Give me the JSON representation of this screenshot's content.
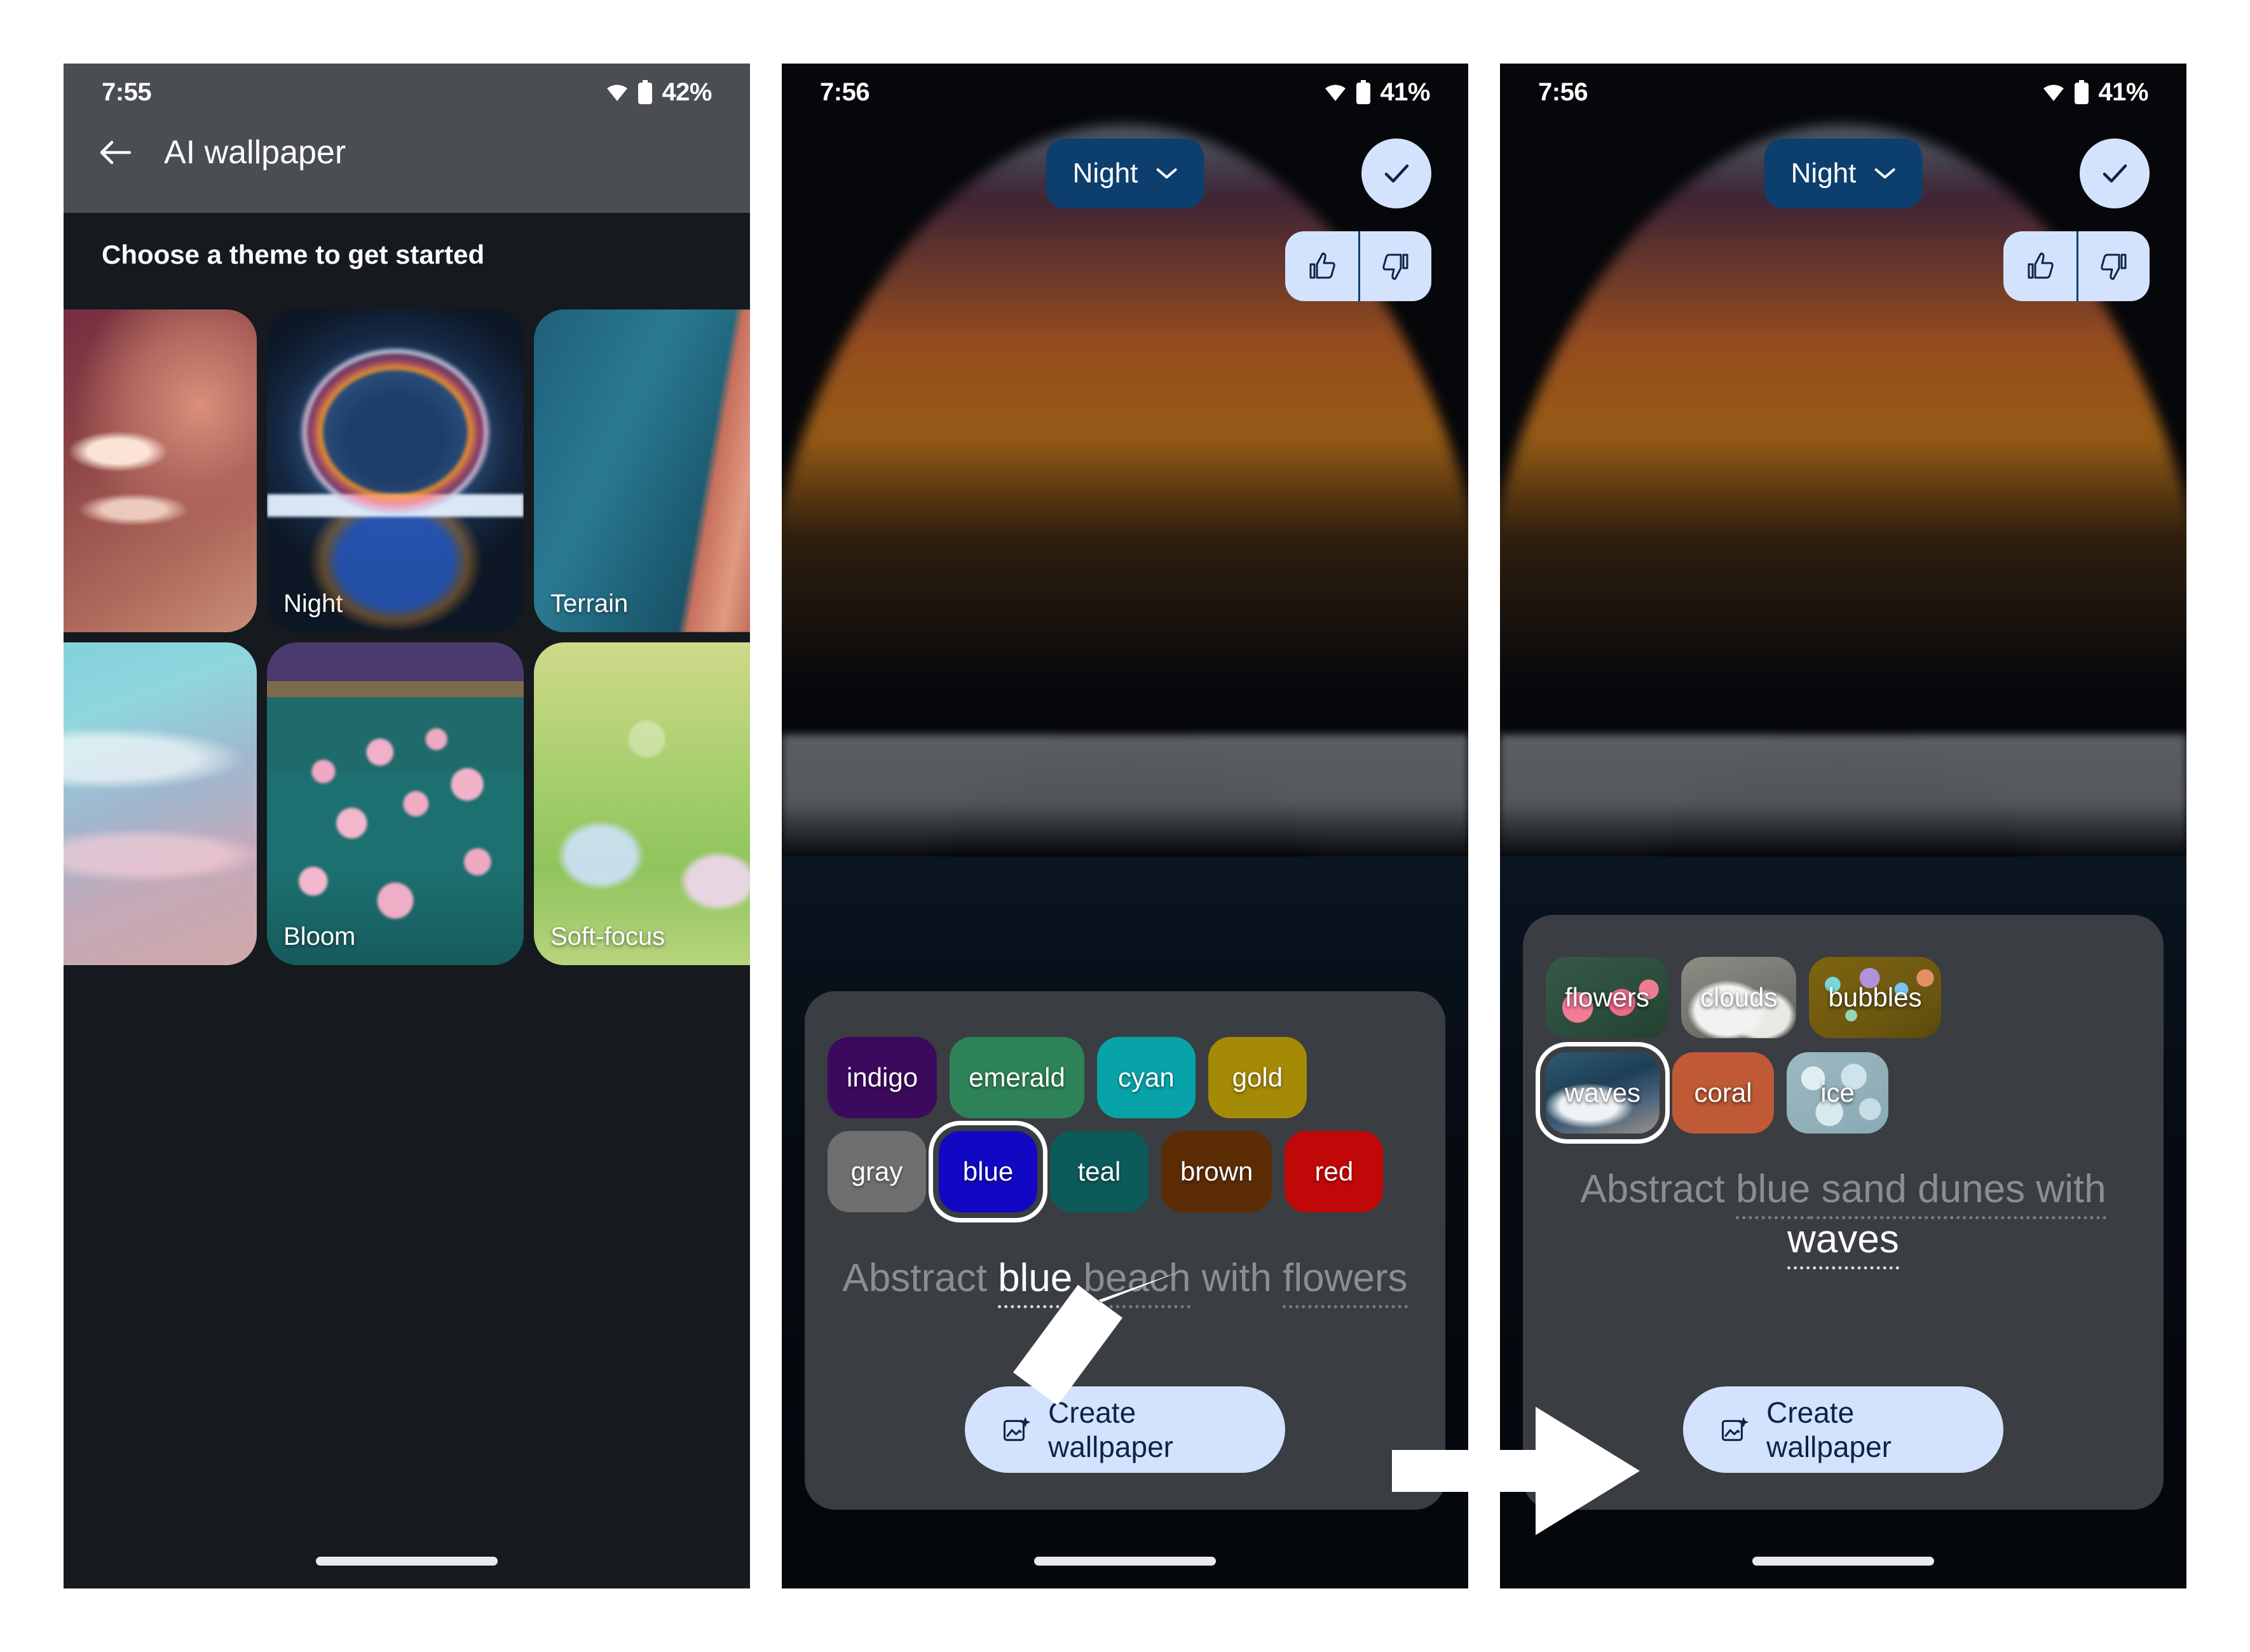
{
  "panels": [
    {
      "status": {
        "time": "7:55",
        "battery": "42%",
        "wifi_icon": "wifi-icon",
        "battery_icon": "battery-icon"
      },
      "appbar": {
        "back_icon": "back-arrow-icon",
        "title": "AI wallpaper"
      },
      "section_label": "Choose a theme to get started",
      "themes": [
        {
          "label": "",
          "name": "theme-tile-bee",
          "art": "art-bee"
        },
        {
          "label": "Night",
          "name": "theme-tile-night",
          "art": "art-night"
        },
        {
          "label": "Terrain",
          "name": "theme-tile-terrain",
          "art": "art-terrain"
        },
        {
          "label": "",
          "name": "theme-tile-smoke",
          "art": "art-smoke"
        },
        {
          "label": "Bloom",
          "name": "theme-tile-bloom",
          "art": "art-bloom"
        },
        {
          "label": "Soft-focus",
          "name": "theme-tile-soft-focus",
          "art": "art-soft"
        }
      ]
    },
    {
      "status": {
        "time": "7:56",
        "battery": "41%",
        "wifi_icon": "wifi-icon",
        "battery_icon": "battery-icon"
      },
      "theme_selector": {
        "label": "Night",
        "chevron_icon": "chevron-down-icon"
      },
      "confirm_icon": "check-icon",
      "thumbs_up_icon": "thumb-up-icon",
      "thumbs_down_icon": "thumb-down-icon",
      "chips_row1": [
        {
          "label": "indigo",
          "color": "#3b0a5c",
          "selected": false
        },
        {
          "label": "emerald",
          "color": "#2e8257",
          "selected": false
        },
        {
          "label": "cyan",
          "color": "#07a3a8",
          "selected": false
        },
        {
          "label": "gold",
          "color": "#a58a06",
          "selected": false
        }
      ],
      "chips_row2": [
        {
          "label": "gray",
          "color": "#6f6f6f",
          "selected": false
        },
        {
          "label": "blue",
          "color": "#1208c4",
          "selected": true
        },
        {
          "label": "teal",
          "color": "#0d5a5a",
          "selected": false
        },
        {
          "label": "brown",
          "color": "#5c2c05",
          "selected": false
        },
        {
          "label": "red",
          "color": "#c00808",
          "selected": false
        }
      ],
      "prompt": {
        "parts": [
          {
            "text": "Abstract ",
            "highlight": false,
            "dotted": false
          },
          {
            "text": "blue",
            "highlight": true,
            "dotted": true
          },
          {
            "text": " ",
            "highlight": false,
            "dotted": false
          },
          {
            "text": "beach",
            "highlight": false,
            "dotted": true
          },
          {
            "text": " with ",
            "highlight": false,
            "dotted": false
          },
          {
            "text": "flowers",
            "highlight": false,
            "dotted": true
          }
        ]
      },
      "create_button": {
        "label": "Create wallpaper",
        "icon": "image-sparkle-icon"
      },
      "annotation_arrow": "arrow-up-right"
    },
    {
      "status": {
        "time": "7:56",
        "battery": "41%",
        "wifi_icon": "wifi-icon",
        "battery_icon": "battery-icon"
      },
      "theme_selector": {
        "label": "Night",
        "chevron_icon": "chevron-down-icon"
      },
      "confirm_icon": "check-icon",
      "thumbs_up_icon": "thumb-up-icon",
      "thumbs_down_icon": "thumb-down-icon",
      "chips_row1": [
        {
          "label": "flowers",
          "art": "ic-flowers",
          "selected": false
        },
        {
          "label": "clouds",
          "art": "ic-clouds",
          "selected": false
        },
        {
          "label": "bubbles",
          "art": "ic-bubbles",
          "selected": false
        }
      ],
      "chips_row2": [
        {
          "label": "waves",
          "art": "ic-waves",
          "selected": true
        },
        {
          "label": "coral",
          "color": "#c05a36",
          "selected": false
        },
        {
          "label": "ice",
          "art": "ic-ice",
          "selected": false
        }
      ],
      "prompt": {
        "parts": [
          {
            "text": "Abstract ",
            "highlight": false,
            "dotted": false
          },
          {
            "text": "blue",
            "highlight": false,
            "dotted": true
          },
          {
            "text": " sand dunes with ",
            "highlight": false,
            "dotted": true
          },
          {
            "text": "waves",
            "highlight": true,
            "dotted": true
          }
        ]
      },
      "create_button": {
        "label": "Create wallpaper",
        "icon": "image-sparkle-icon"
      },
      "annotation_arrow": "arrow-right"
    }
  ],
  "colors": {
    "accent_blue": "#d3e3fd",
    "accent_dark_blue": "#0d3f6e",
    "sheet_bg": "#3a3d41",
    "phone_bg": "#16191d",
    "appbar_bg": "#4a4d52"
  }
}
